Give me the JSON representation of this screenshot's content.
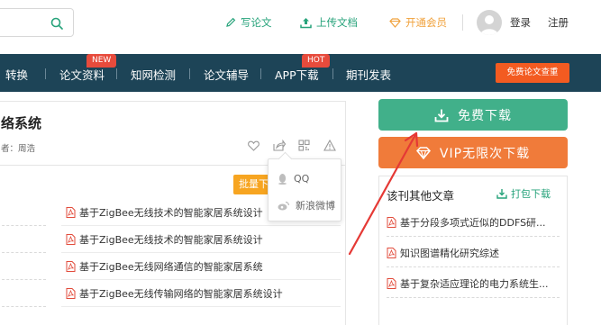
{
  "header": {
    "links": {
      "write": "写论文",
      "upload": "上传文档",
      "vip": "开通会员",
      "login": "登录",
      "register": "注册"
    }
  },
  "nav": {
    "items": [
      "转换",
      "论文资料",
      "知网检测",
      "论文辅导",
      "APP下载",
      "期刊发表"
    ],
    "badges": {
      "new": "NEW",
      "hot": "HOT"
    },
    "free_check": "免费论文查重"
  },
  "document": {
    "title": "络系统",
    "meta": "者：周浩",
    "bulk_button": "批量下",
    "related": [
      "基于ZigBee无线技术的智能家居系统设计",
      "基于ZigBee无线技术的智能家居系统设计",
      "基于ZigBee无线网络通信的智能家居系统",
      "基于ZigBee无线传输网络的智能家居系统设计"
    ]
  },
  "share_popup": {
    "qq": "QQ",
    "weibo": "新浪微博"
  },
  "sidebar": {
    "free_download": "免费下载",
    "vip_download": "VIP无限次下载",
    "other_title": "该刊其他文章",
    "pack_download": "打包下载",
    "articles": [
      "基于分段多项式近似的DDFS研...",
      "知识图谱精化研究综述",
      "基于复杂适应理论的电力系统生..."
    ]
  },
  "colors": {
    "brand_green": "#41b08a",
    "link_green": "#27a37b",
    "vip_orange": "#f07b3a",
    "nav_bg": "#1d4457",
    "badge_red": "#e74b3c",
    "annotation_red": "#e53935"
  }
}
